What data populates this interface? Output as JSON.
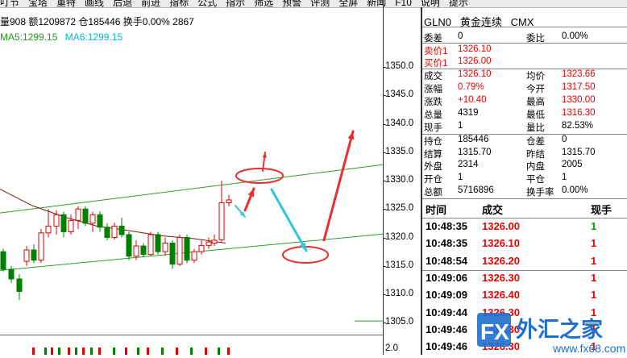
{
  "menu": {
    "items": [
      "叮节",
      "宝塔",
      "重特",
      "画线",
      "后退",
      "前进",
      "指标",
      "公式",
      "指示",
      "筛选",
      "预警",
      "评测",
      "全屏",
      "新闻",
      "F10",
      "说明",
      "提示"
    ]
  },
  "infobar": {
    "text": "量908 额1209872 仓185446 换手0.00% 2867"
  },
  "ma": {
    "ma5": "MA5:1299.15",
    "ma6": "MA6:1299.15"
  },
  "price_axis": {
    "labels": [
      "1350.0",
      "1345.0",
      "1340.0",
      "1335.0",
      "1330.0",
      "1325.0",
      "1320.0",
      "1315.0",
      "1310.0",
      "1305.0"
    ],
    "lower": "2.0"
  },
  "quote": {
    "code": "GLN0",
    "name": "黄金连续",
    "exchange": "CMX",
    "rows": [
      {
        "l1": "委差",
        "v1": "0",
        "c1": "",
        "l2": "委比",
        "v2": "0.00%",
        "c2": ""
      },
      {
        "l1": "卖价1",
        "v1": "1326.10",
        "c1": "red",
        "l2": "",
        "v2": "",
        "c2": ""
      },
      {
        "l1": "买价1",
        "v1": "1326.00",
        "c1": "red",
        "l2": "",
        "v2": "",
        "c2": ""
      },
      {
        "l1": "成交",
        "v1": "1326.10",
        "c1": "red",
        "l2": "均价",
        "v2": "1323.66",
        "c2": "red"
      },
      {
        "l1": "涨幅",
        "v1": "0.79%",
        "c1": "red",
        "l2": "今开",
        "v2": "1317.50",
        "c2": "red"
      },
      {
        "l1": "涨跌",
        "v1": "+10.40",
        "c1": "red",
        "l2": "最高",
        "v2": "1330.00",
        "c2": "red"
      },
      {
        "l1": "总量",
        "v1": "4319",
        "c1": "",
        "l2": "最低",
        "v2": "1316.30",
        "c2": "red"
      },
      {
        "l1": "现手",
        "v1": "1",
        "c1": "",
        "l2": "量比",
        "v2": "82.53%",
        "c2": ""
      },
      {
        "l1": "持仓",
        "v1": "185446",
        "c1": "",
        "l2": "仓差",
        "v2": "0",
        "c2": ""
      },
      {
        "l1": "结算",
        "v1": "1315.70",
        "c1": "",
        "l2": "昨结",
        "v2": "1315.70",
        "c2": ""
      },
      {
        "l1": "外盘",
        "v1": "2314",
        "c1": "",
        "l2": "内盘",
        "v2": "2005",
        "c2": ""
      },
      {
        "l1": "开仓",
        "v1": "1",
        "c1": "",
        "l2": "平仓",
        "v2": "1",
        "c2": ""
      },
      {
        "l1": "总额",
        "v1": "5716896",
        "c1": "",
        "l2": "换手率",
        "v2": "0.00%",
        "c2": ""
      }
    ]
  },
  "trades": {
    "headers": {
      "time": "时间",
      "price": "成交",
      "qty": "现手"
    },
    "rows": [
      {
        "time": "10:48:35",
        "price": "1326.00",
        "qty": "1",
        "qc": "green"
      },
      {
        "time": "10:48:35",
        "price": "1326.10",
        "qty": "1",
        "qc": "red"
      },
      {
        "time": "10:48:54",
        "price": "1326.20",
        "qty": "1",
        "qc": "red"
      },
      {
        "time": "10:49:06",
        "price": "1326.30",
        "qty": "1",
        "qc": "red"
      },
      {
        "time": "10:49:09",
        "price": "1326.40",
        "qty": "1",
        "qc": "red"
      },
      {
        "time": "10:49:44",
        "price": "1326.30",
        "qty": "1",
        "qc": "red"
      },
      {
        "time": "10:49:46",
        "price": "1326.30",
        "qty": "1",
        "qc": "red"
      },
      {
        "time": "10:49:46",
        "price": "1326.30",
        "qty": "1",
        "qc": "red"
      }
    ]
  },
  "watermark": {
    "text": "外汇之家",
    "brand": "FX",
    "url": "www.fx68.com"
  },
  "colors": {
    "up": "#e00000",
    "down": "#008000",
    "channel": "#2a9d2a",
    "annotation": "#e83030",
    "arrow_cyan": "#2ec8d8"
  }
}
